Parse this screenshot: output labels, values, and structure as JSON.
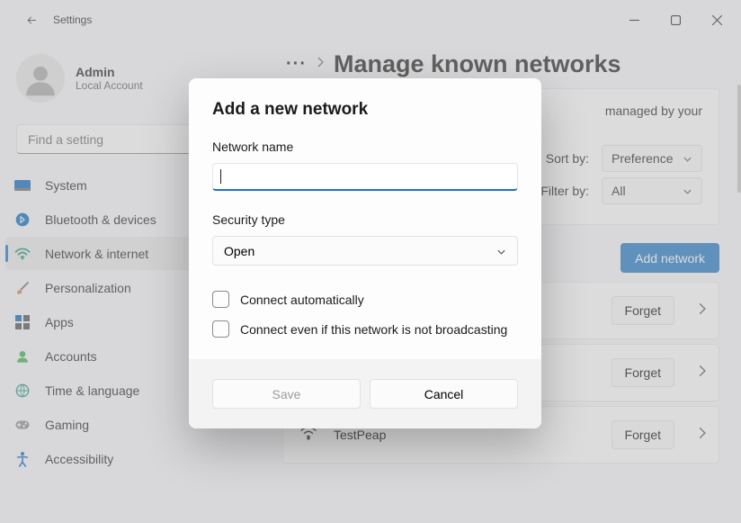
{
  "titlebar": {
    "title": "Settings"
  },
  "user": {
    "name": "Admin",
    "sub": "Local Account"
  },
  "search": {
    "placeholder": "Find a setting"
  },
  "sidebar": {
    "items": [
      {
        "label": "System",
        "icon": "system",
        "selected": false
      },
      {
        "label": "Bluetooth & devices",
        "icon": "bluetooth",
        "selected": false
      },
      {
        "label": "Network & internet",
        "icon": "wifi",
        "selected": true
      },
      {
        "label": "Personalization",
        "icon": "brush",
        "selected": false
      },
      {
        "label": "Apps",
        "icon": "apps",
        "selected": false
      },
      {
        "label": "Accounts",
        "icon": "person",
        "selected": false
      },
      {
        "label": "Time & language",
        "icon": "globe",
        "selected": false
      },
      {
        "label": "Gaming",
        "icon": "game",
        "selected": false
      },
      {
        "label": "Accessibility",
        "icon": "access",
        "selected": false
      }
    ]
  },
  "main": {
    "page_title": "Manage known networks",
    "info_card": "managed by your",
    "sort_label": "Sort by:",
    "sort_value": "Preference",
    "filter_label": "Filter by:",
    "filter_value": "All",
    "add_button": "Add network",
    "forget_label": "Forget",
    "networks": [
      {
        "name": ""
      },
      {
        "name": ""
      },
      {
        "name": "TestPeap"
      }
    ]
  },
  "dialog": {
    "title": "Add a new network",
    "network_name_label": "Network name",
    "network_name_value": "",
    "security_type_label": "Security type",
    "security_type_value": "Open",
    "connect_auto": "Connect automatically",
    "connect_hidden": "Connect even if this network is not broadcasting",
    "save": "Save",
    "cancel": "Cancel"
  }
}
